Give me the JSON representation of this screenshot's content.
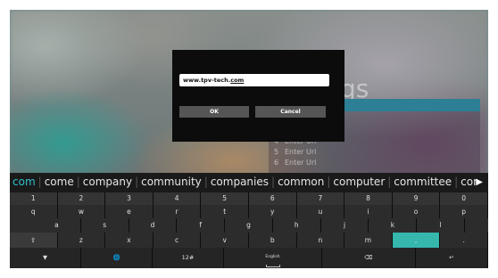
{
  "background": {
    "title": "Settings",
    "visible_title_fragment": "gs",
    "list": [
      {
        "num": "4",
        "label": "Enter Url"
      },
      {
        "num": "5",
        "label": "Enter Url"
      },
      {
        "num": "6",
        "label": "Enter Url"
      }
    ]
  },
  "dialog": {
    "url_value_prefix": "www.tpv-tech.",
    "url_value_suffix": "com",
    "ok_label": "OK",
    "cancel_label": "Cancel"
  },
  "keyboard": {
    "suggestions": [
      "com",
      "come",
      "company",
      "community",
      "companies",
      "common",
      "computer",
      "committee",
      "cor"
    ],
    "suggest_more_icon": "play-right-icon",
    "row1": [
      "1",
      "2",
      "3",
      "4",
      "5",
      "6",
      "7",
      "8",
      "9",
      "0"
    ],
    "row2": [
      "q",
      "w",
      "e",
      "r",
      "t",
      "y",
      "u",
      "i",
      "o",
      "p"
    ],
    "row3": [
      "a",
      "s",
      "d",
      "f",
      "g",
      "h",
      "j",
      "k",
      "l"
    ],
    "row4": [
      "z",
      "x",
      "c",
      "v",
      "b",
      "n",
      "m",
      ",",
      "."
    ],
    "shift_icon": "shift-icon",
    "hide_icon": "hide-keyboard-icon",
    "globe_icon": "globe-icon",
    "symbols_label": "12#",
    "space_label": "English",
    "backspace_icon": "backspace-icon",
    "enter_icon": "enter-icon",
    "accent_color": "#35b7ad"
  }
}
